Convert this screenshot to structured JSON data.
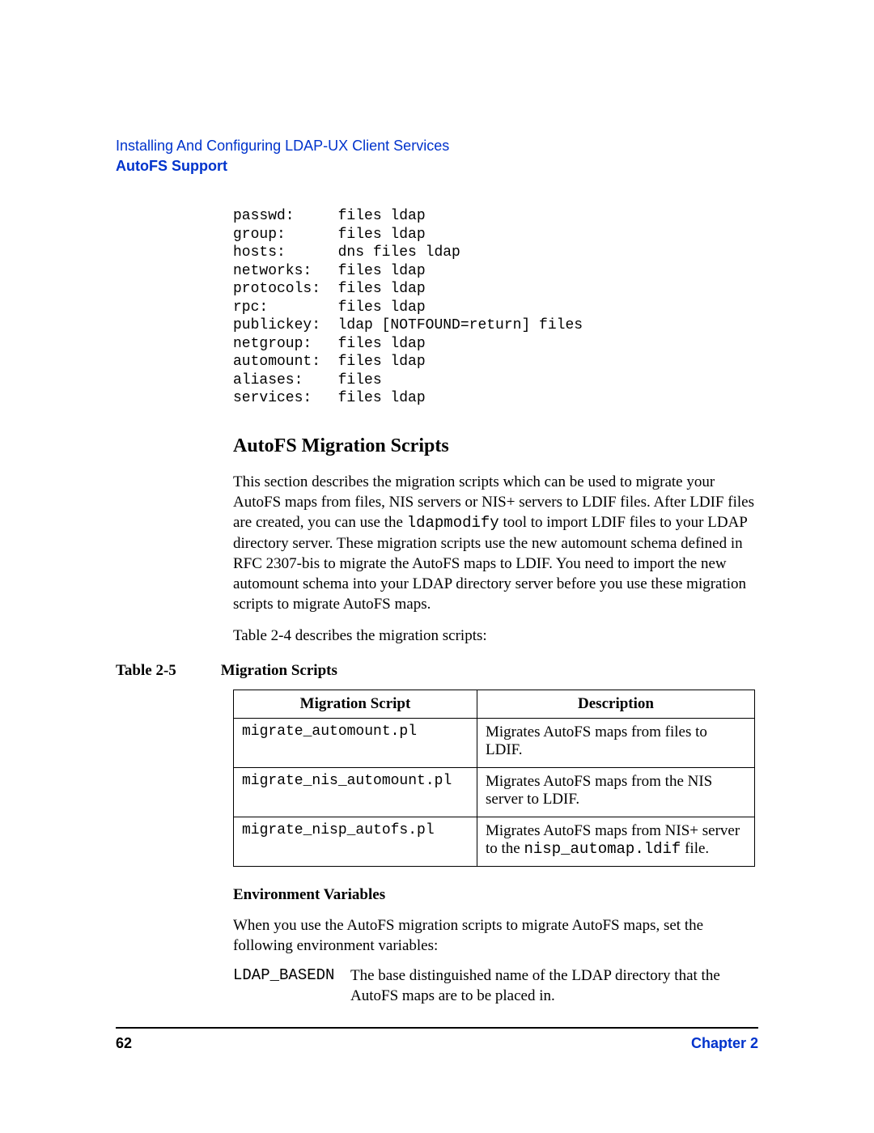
{
  "header": {
    "chapter_path": "Installing And Configuring LDAP-UX Client Services",
    "section": "AutoFS Support"
  },
  "config_block": "passwd:     files ldap\ngroup:      files ldap\nhosts:      dns files ldap\nnetworks:   files ldap\nprotocols:  files ldap\nrpc:        files ldap\npublickey:  ldap [NOTFOUND=return] files\nnetgroup:   files ldap\nautomount:  files ldap\naliases:    files\nservices:   files ldap",
  "section_heading": "AutoFS Migration Scripts",
  "paragraph1_a": "This section describes the migration scripts which can be used to migrate your AutoFS maps from files, NIS servers or NIS+ servers to LDIF files. After LDIF files are created, you can use the ",
  "paragraph1_code": "ldapmodify",
  "paragraph1_b": " tool to import LDIF files to your LDAP directory server. These migration scripts use the new automount schema defined in RFC 2307-bis to migrate the AutoFS maps to LDIF. You need to import the new automount schema into your LDAP directory server before you use these migration scripts to migrate AutoFS maps.",
  "paragraph2": "Table 2-4 describes the migration scripts:",
  "table": {
    "label": "Table 2-5",
    "caption": "Migration Scripts",
    "headers": {
      "col1": "Migration Script",
      "col2": "Description"
    },
    "rows": [
      {
        "script": "migrate_automount.pl",
        "desc_a": "Migrates AutoFS maps from files to LDIF.",
        "desc_code": "",
        "desc_b": ""
      },
      {
        "script": "migrate_nis_automount.pl",
        "desc_a": "Migrates AutoFS maps from the NIS server to LDIF.",
        "desc_code": "",
        "desc_b": ""
      },
      {
        "script": "migrate_nisp_autofs.pl",
        "desc_a": "Migrates AutoFS maps from NIS+ server to the ",
        "desc_code": "nisp_automap.ldif",
        "desc_b": " file."
      }
    ]
  },
  "subheading": "Environment Variables",
  "paragraph3": "When you use the AutoFS migration scripts to migrate AutoFS maps, set the following environment variables:",
  "env": {
    "key": "LDAP_BASEDN",
    "val": "The base distinguished name of the LDAP directory that the AutoFS maps are to be placed in."
  },
  "footer": {
    "page": "62",
    "chapter": "Chapter 2"
  }
}
